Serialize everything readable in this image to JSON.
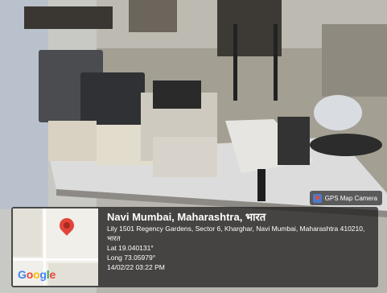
{
  "badge": {
    "label": "GPS Map Camera",
    "icon": "gps-map-camera-icon"
  },
  "map": {
    "logo_text": "Google",
    "pin_icon": "location-pin-icon"
  },
  "location": {
    "title": "Navi Mumbai, Maharashtra, भारत",
    "address": "Lily 1501 Regency Gardens, Sector 6, Kharghar, Navi Mumbai, Maharashtra 410210, भारत",
    "lat": "Lat 19.040131°",
    "long": "Long 73.05979°",
    "datetime": "14/02/22 03:22 PM"
  }
}
